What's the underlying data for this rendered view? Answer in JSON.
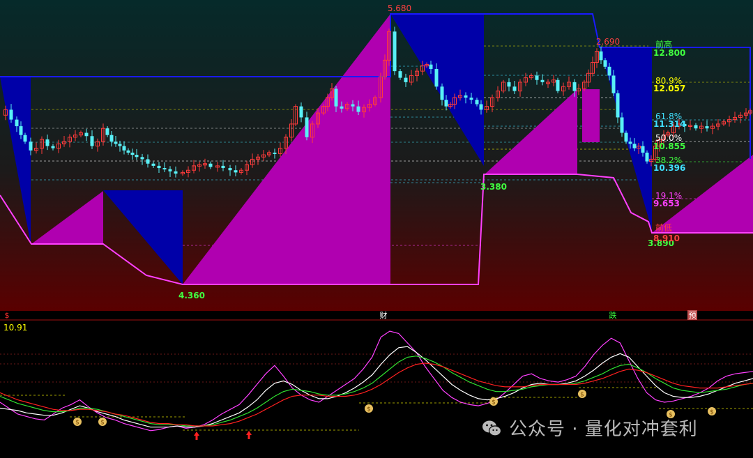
{
  "chart_data": [
    {
      "type": "candlestick",
      "title": "",
      "y_axis": {
        "ylim": [
          3.35,
          5.82
        ],
        "visible": false
      },
      "colors": {
        "bg_top": "#062a2a",
        "bg_bottom": "#5a0000",
        "up_candle": "#ff3b3b",
        "down_candle": "#59f0f6",
        "box_high": "#0000a8",
        "box_low": "#b000b0",
        "zigzag": "#ff40ff",
        "resistance": "#1a1aff"
      },
      "peak_labels": [
        {
          "text": "5.680",
          "value": 5.68,
          "color": "#ff4040"
        },
        {
          "text": "2.690",
          "value": 5.42,
          "color": "#ff4040"
        }
      ],
      "trough_labels": [
        {
          "text": "4.360",
          "value": 4.36,
          "color": "#40ff40"
        },
        {
          "text": "3.380",
          "value": 4.6,
          "color": "#40ff40"
        },
        {
          "text": "3.890",
          "value": 4.46,
          "color": "#40ff40"
        }
      ],
      "fib_levels": [
        {
          "label": "前高",
          "value": "12.800",
          "color": "#40ff40"
        },
        {
          "label": "80.9%",
          "value": "12.057",
          "color": "#ffff00"
        },
        {
          "label": "61.8%",
          "value": "11.314",
          "color": "#40e0ff"
        },
        {
          "label": "50.0%",
          "value": "10.855",
          "color": "#ffffff",
          "value_color": "#40ff40"
        },
        {
          "label": "38.2%",
          "value": "10.396",
          "color": "#40ff40",
          "value_color": "#40e0ff"
        },
        {
          "label": "19.1%",
          "value": "9.653",
          "color": "#ff40ff"
        },
        {
          "label": "前低",
          "value": "8.910",
          "color": "#ff4040"
        }
      ],
      "event_markers": [
        {
          "text": "$",
          "color": "#ff3030",
          "bg": ""
        },
        {
          "text": "财",
          "color": "#ffffff",
          "bg": ""
        },
        {
          "text": "跌",
          "color": "#40ff40",
          "bg": ""
        },
        {
          "text": "预",
          "color": "#ffffff",
          "bg": "#c05050"
        }
      ]
    },
    {
      "type": "line",
      "title": "",
      "readout": "10.91",
      "readout_color": "#ffff00",
      "ylim": [
        0,
        100
      ],
      "series": [
        {
          "color": "#ff40ff",
          "values": [
            40,
            35,
            30,
            28,
            26,
            25,
            30,
            35,
            38,
            42,
            36,
            31,
            27,
            25,
            22,
            20,
            18,
            16,
            17,
            19,
            20,
            18,
            19,
            21,
            25,
            30,
            34,
            38,
            46,
            55,
            64,
            71,
            62,
            52,
            46,
            42,
            40,
            45,
            50,
            55,
            60,
            68,
            78,
            95,
            100,
            98,
            90,
            82,
            70,
            60,
            50,
            44,
            40,
            38,
            37,
            39,
            42,
            48,
            55,
            62,
            64,
            60,
            58,
            57,
            59,
            62,
            70,
            80,
            88,
            94,
            90,
            75,
            60,
            48,
            42,
            40,
            41,
            43,
            45,
            48,
            52,
            58,
            62,
            64,
            65,
            66
          ]
        },
        {
          "color": "#ffffff",
          "values": [
            35,
            34,
            33,
            31,
            30,
            29,
            29,
            31,
            34,
            37,
            35,
            32,
            30,
            28,
            25,
            23,
            21,
            19,
            19,
            19,
            20,
            19,
            19,
            20,
            22,
            25,
            28,
            31,
            36,
            42,
            50,
            56,
            58,
            55,
            50,
            46,
            43,
            43,
            45,
            48,
            52,
            57,
            63,
            72,
            80,
            86,
            87,
            82,
            76,
            69,
            62,
            55,
            50,
            46,
            43,
            42,
            43,
            45,
            48,
            52,
            55,
            56,
            55,
            55,
            56,
            58,
            62,
            67,
            73,
            78,
            81,
            78,
            70,
            62,
            54,
            48,
            45,
            44,
            44,
            45,
            47,
            50,
            53,
            56,
            58,
            60
          ]
        },
        {
          "color": "#30e030",
          "values": [
            45,
            42,
            39,
            37,
            35,
            33,
            32,
            32,
            33,
            35,
            35,
            34,
            32,
            30,
            28,
            26,
            24,
            22,
            21,
            21,
            21,
            20,
            20,
            20,
            21,
            23,
            25,
            28,
            31,
            35,
            40,
            45,
            49,
            51,
            50,
            49,
            47,
            46,
            46,
            47,
            49,
            52,
            56,
            62,
            68,
            74,
            78,
            79,
            77,
            74,
            70,
            65,
            61,
            57,
            54,
            51,
            49,
            49,
            50,
            51,
            53,
            54,
            55,
            55,
            55,
            56,
            58,
            61,
            64,
            68,
            71,
            72,
            69,
            65,
            60,
            56,
            52,
            50,
            49,
            48,
            49,
            50,
            51,
            53,
            55,
            56
          ]
        },
        {
          "color": "#ff2020",
          "values": [
            48,
            45,
            42,
            40,
            38,
            36,
            34,
            33,
            33,
            34,
            34,
            33,
            32,
            30,
            29,
            27,
            25,
            23,
            22,
            22,
            21,
            21,
            20,
            20,
            20,
            21,
            22,
            24,
            27,
            30,
            34,
            38,
            42,
            45,
            46,
            46,
            46,
            45,
            45,
            45,
            46,
            48,
            51,
            55,
            60,
            65,
            69,
            72,
            73,
            72,
            70,
            67,
            64,
            61,
            58,
            56,
            54,
            53,
            53,
            53,
            54,
            55,
            55,
            55,
            55,
            55,
            56,
            58,
            60,
            63,
            66,
            68,
            67,
            65,
            62,
            59,
            56,
            54,
            53,
            52,
            52,
            52,
            53,
            54,
            55,
            56
          ]
        }
      ]
    }
  ],
  "watermark": {
    "text": "公众号 · 量化对冲套利"
  }
}
